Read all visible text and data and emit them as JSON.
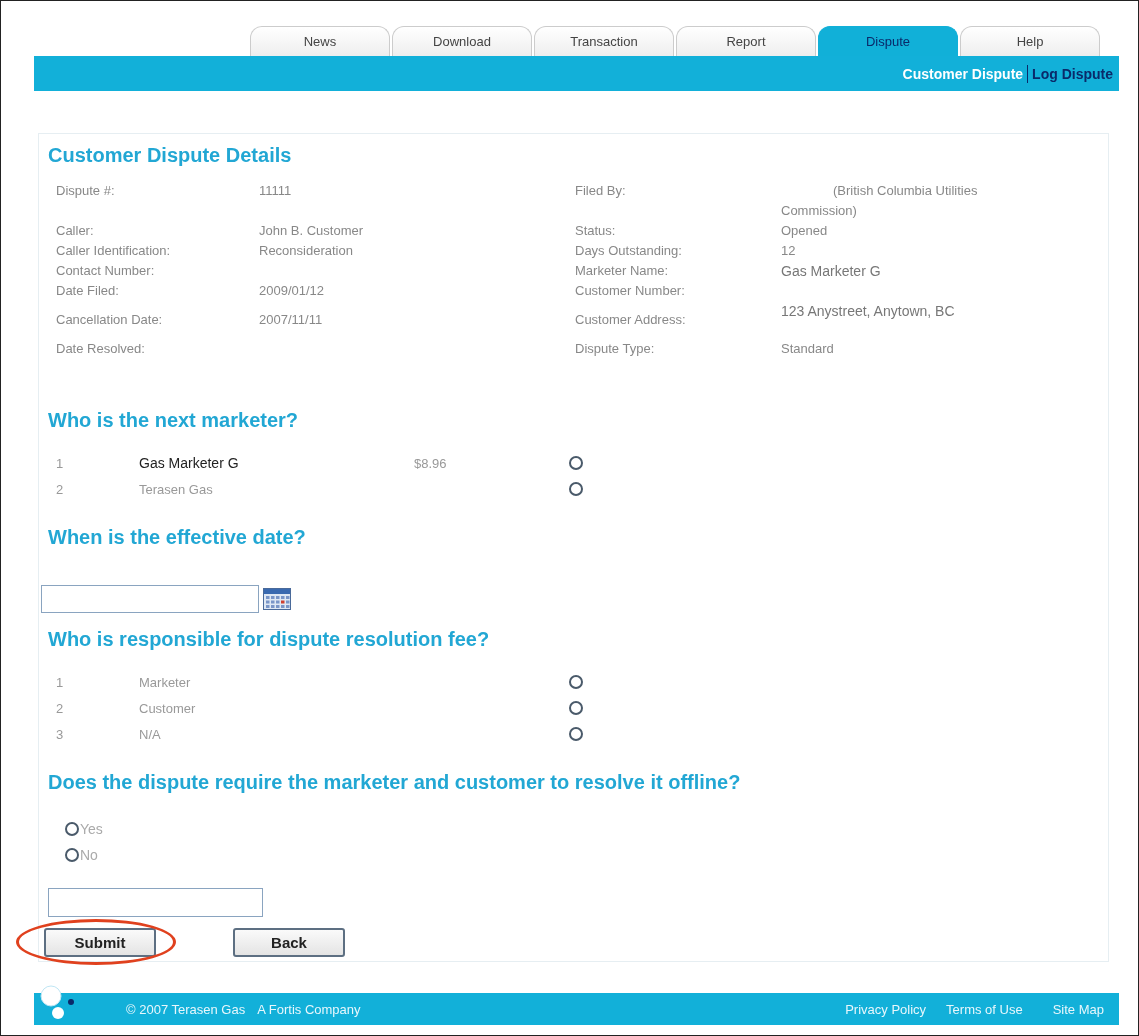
{
  "tabs": [
    {
      "label": "News",
      "selected": false
    },
    {
      "label": "Download",
      "selected": false
    },
    {
      "label": "Transaction",
      "selected": false
    },
    {
      "label": "Report",
      "selected": false
    },
    {
      "label": "Dispute",
      "selected": true
    },
    {
      "label": "Help",
      "selected": false
    }
  ],
  "subnav": [
    {
      "label": "Customer Dispute",
      "selected": true
    },
    {
      "label": "Log Dispute",
      "selected": false
    }
  ],
  "details": {
    "title": "Customer Dispute Details",
    "left": [
      {
        "label": "Dispute #:",
        "value": "11111"
      },
      {
        "label": "Caller:",
        "value": "John B. Customer"
      },
      {
        "label": "Caller Identification:",
        "value": "Reconsideration"
      },
      {
        "label": "Contact Number:"
      },
      {
        "label": "Date Filed:",
        "value": "2009/01/12"
      },
      {
        "label": "Cancellation Date:",
        "value": "2007/11/11"
      },
      {
        "label": "Date Resolved:"
      }
    ],
    "right": [
      {
        "label": "Filed By:",
        "value": "(British Columbia Utilities Commission)"
      },
      {
        "label": "Status:",
        "value": "Opened"
      },
      {
        "label": "Days Outstanding:",
        "value": "12"
      },
      {
        "label": "Marketer Name:",
        "value": "Gas Marketer G"
      },
      {
        "label": "Customer Number:"
      },
      {
        "label": "Customer Address:",
        "value": "123 Anystreet, Anytown, BC"
      },
      {
        "label": "Dispute Type:",
        "value": "Standard"
      }
    ]
  },
  "next_marketer": {
    "title": "Who is the next marketer?",
    "options": [
      {
        "number": "1",
        "name": "Gas Marketer G",
        "price": "$8.96",
        "emphasized": true,
        "selected": false
      },
      {
        "number": "2",
        "name": "Terasen Gas",
        "emphasized": false,
        "selected": false
      }
    ]
  },
  "effective_date": {
    "title": "When is the effective date?"
  },
  "resolution_fee": {
    "title": "Who is responsible for dispute resolution fee?",
    "options": [
      {
        "number": "1",
        "name": "Marketer",
        "emphasized": false,
        "selected": false
      },
      {
        "number": "2",
        "name": "Customer",
        "emphasized": false,
        "selected": false
      },
      {
        "number": "3",
        "name": "N/A",
        "emphasized": false,
        "selected": false
      }
    ]
  },
  "offline": {
    "title": "Does the dispute require the marketer and customer to resolve it offline?",
    "options": [
      {
        "label": "Yes",
        "selected": false
      },
      {
        "label": "No",
        "selected": false
      }
    ]
  },
  "buttons": [
    {
      "label": "Submit",
      "circled": true
    },
    {
      "label": "Back",
      "circled": false
    }
  ],
  "footer": {
    "copyright": "© 2007 Terasen Gas",
    "company": "A Fortis Company",
    "links": [
      "Privacy Policy",
      "Terms of Use",
      "Site Map"
    ]
  }
}
